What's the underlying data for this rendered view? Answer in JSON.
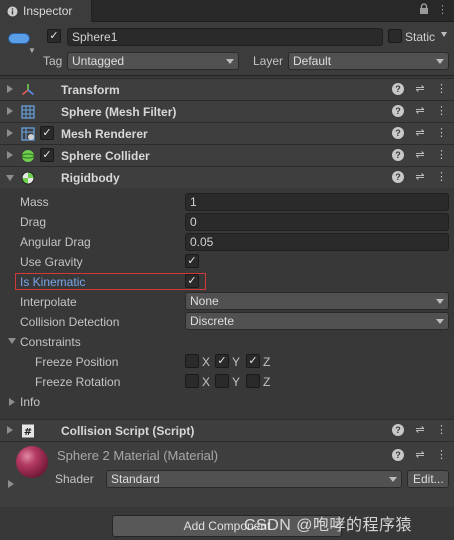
{
  "window": {
    "tab_title": "Inspector",
    "tab_icon": "info-icon",
    "tools": [
      "lock-icon",
      "menu-icon"
    ]
  },
  "object": {
    "active": true,
    "name": "Sphere1",
    "static_label": "Static",
    "static_checked": false,
    "tag_label": "Tag",
    "tag_value": "Untagged",
    "layer_label": "Layer",
    "layer_value": "Default"
  },
  "components": {
    "transform": {
      "title": "Transform",
      "icon": "transform-icon"
    },
    "mesh_filter": {
      "title": "Sphere (Mesh Filter)",
      "icon": "mesh-filter-icon"
    },
    "mesh_renderer": {
      "title": "Mesh Renderer",
      "icon": "mesh-renderer-icon",
      "enabled": true
    },
    "sphere_collider": {
      "title": "Sphere Collider",
      "icon": "sphere-collider-icon",
      "enabled": true
    },
    "rigidbody": {
      "title": "Rigidbody",
      "icon": "rigidbody-icon",
      "mass_label": "Mass",
      "mass": "1",
      "drag_label": "Drag",
      "drag": "0",
      "angular_drag_label": "Angular Drag",
      "angular_drag": "0.05",
      "use_gravity_label": "Use Gravity",
      "use_gravity": true,
      "is_kinematic_label": "Is Kinematic",
      "is_kinematic": true,
      "interpolate_label": "Interpolate",
      "interpolate": "None",
      "collision_detection_label": "Collision Detection",
      "collision_detection": "Discrete",
      "constraints_label": "Constraints",
      "freeze_position_label": "Freeze Position",
      "freeze_rotation_label": "Freeze Rotation",
      "axis_x": "X",
      "axis_y": "Y",
      "axis_z": "Z",
      "freeze_position": {
        "x": false,
        "y": true,
        "z": true
      },
      "freeze_rotation": {
        "x": false,
        "y": false,
        "z": false
      },
      "info_label": "Info"
    },
    "collision_script": {
      "title": "Collision Script (Script)",
      "icon": "script-icon"
    }
  },
  "material": {
    "title": "Sphere 2 Material (Material)",
    "shader_label": "Shader",
    "shader_value": "Standard",
    "edit_label": "Edit..."
  },
  "add_component_label": "Add Component",
  "watermark": "CSDN @咆哮的程序猿",
  "colors": {
    "highlight": "#d23a3a",
    "kinematic_label": "#7aa6e8",
    "icon_blue": "#5b9ee8"
  }
}
